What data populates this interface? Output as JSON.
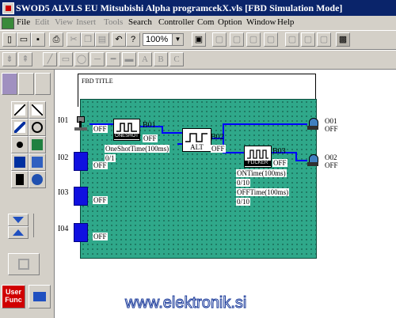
{
  "window": {
    "title": "SWOD5 ALVLS EU  Mitsubishi Alpha programcekX.vls  [FBD  Simulation Mode]"
  },
  "menu": {
    "items": [
      {
        "label": "File",
        "enabled": true
      },
      {
        "label": "Edit",
        "enabled": false
      },
      {
        "label": "View",
        "enabled": false
      },
      {
        "label": "Insert",
        "enabled": false
      },
      {
        "label": "Tools",
        "enabled": false
      },
      {
        "label": "Search",
        "enabled": true
      },
      {
        "label": "Controller",
        "enabled": true
      },
      {
        "label": "Com",
        "enabled": true
      },
      {
        "label": "Option",
        "enabled": true
      },
      {
        "label": "Window",
        "enabled": true
      },
      {
        "label": "Help",
        "enabled": true
      }
    ]
  },
  "toolbar": {
    "zoom_value": "100%"
  },
  "diagram": {
    "frame_title": "FBD TITLE",
    "inputs": [
      {
        "name": "I01",
        "value": "OFF"
      },
      {
        "name": "I02",
        "value": "OFF"
      },
      {
        "name": "I03",
        "value": "OFF"
      },
      {
        "name": "I04",
        "value": "OFF"
      }
    ],
    "outputs": [
      {
        "name": "O01",
        "value": "OFF"
      },
      {
        "name": "O02",
        "value": "OFF"
      }
    ],
    "blocks": {
      "b01": {
        "id": "B01",
        "label": "ONESHOT",
        "value": "OFF",
        "param": "OneShotTime(100ms)",
        "param_value": "0/1"
      },
      "b02": {
        "id": "B02",
        "label": "ALT",
        "value": "OFF"
      },
      "b03": {
        "id": "B03",
        "label": "FLICKER",
        "value": "OFF",
        "on_time_label": "ONTime(100ms)",
        "on_time_value": "0/10",
        "off_time_label": "OFFTime(100ms)",
        "off_time_value": "0/10"
      }
    }
  },
  "user_func_label": "User Func",
  "watermark": "www.elektronik.si",
  "colors": {
    "titlebar": "#0a246a",
    "canvas": "#2fa88a",
    "io_box": "#1010e0",
    "wire": "#0000ff"
  }
}
